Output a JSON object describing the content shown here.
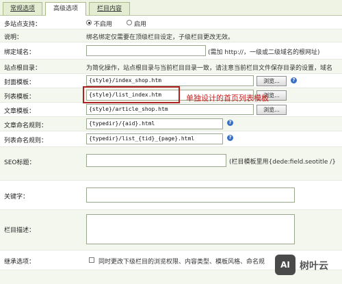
{
  "tabs": [
    {
      "label": "常规选项"
    },
    {
      "label": "高级选项"
    },
    {
      "label": "栏目内容"
    }
  ],
  "fields": {
    "multisite": {
      "label": "多站点支持：",
      "opt_off": "不启用",
      "opt_on": "启用"
    },
    "note": {
      "label": "说明：",
      "text": "绑名绑定仅需要在顶级栏目设定，子级栏目更改无效。"
    },
    "domain": {
      "label": "绑定域名：",
      "value": "",
      "hint": "(需加 http://，一级或二级域名的根网址)"
    },
    "siteroot": {
      "label": "站点根目录：",
      "text": "为简化操作，站点根目录与当前栏目目录一致，请注意当前栏目文件保存目录的设置，域名"
    },
    "cover_tpl": {
      "label": "封面模板：",
      "value": "{style}/index_shop.htm",
      "browse": "浏览..."
    },
    "list_tpl": {
      "label": "列表模板：",
      "value": "{style}/list_index.htm",
      "browse": "浏览..."
    },
    "article_tpl": {
      "label": "文章模板：",
      "value": "{style}/article_shop.htm",
      "browse": "浏览..."
    },
    "article_naming": {
      "label": "文章命名规则：",
      "value": "{typedir}/{aid}.html"
    },
    "list_naming": {
      "label": "列表命名规则：",
      "value": "{typedir}/list_{tid}_{page}.html"
    },
    "seo_title": {
      "label": "SEO标题：",
      "value": "",
      "hint": "(栏目模板里用{dede:field.seotitle /}"
    },
    "keywords": {
      "label": "关键字：",
      "value": ""
    },
    "description": {
      "label": "栏目描述：",
      "value": ""
    },
    "inherit": {
      "label": "继承选项：",
      "text": "同时更改下级栏目的浏览权限、内容类型、模板风格、命名规"
    }
  },
  "annotation": {
    "text": "单独设计的首页列表模板",
    "color": "#c81e1e"
  },
  "help_glyph": "?",
  "watermark": {
    "icon_text": "AI",
    "text": "树叶云"
  }
}
